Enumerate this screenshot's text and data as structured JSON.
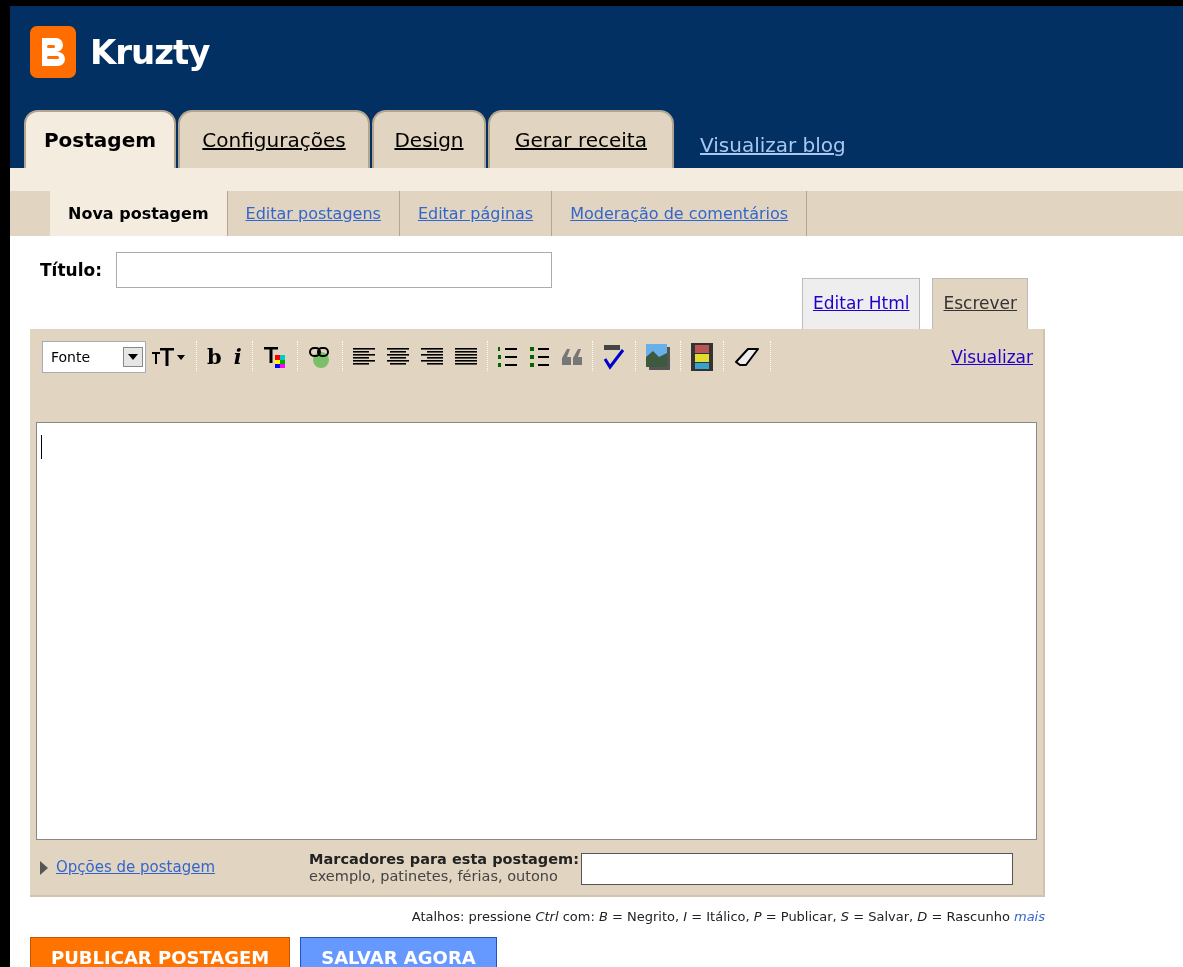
{
  "header": {
    "blog_title": "Kruzty",
    "view_blog_link": "Visualizar blog"
  },
  "tabs": [
    {
      "label": "Postagem",
      "selected": true
    },
    {
      "label": "Configurações",
      "selected": false
    },
    {
      "label": "Design",
      "selected": false
    },
    {
      "label": "Gerar receita",
      "selected": false
    }
  ],
  "subtabs": [
    {
      "label": "Nova postagem",
      "selected": true
    },
    {
      "label": "Editar postagens",
      "selected": false
    },
    {
      "label": "Editar páginas",
      "selected": false
    },
    {
      "label": "Moderação de comentários",
      "selected": false
    }
  ],
  "title_field": {
    "label": "Título:"
  },
  "editor_tabs": [
    {
      "label": "Editar Html",
      "selected": false
    },
    {
      "label": "Escrever",
      "selected": true
    }
  ],
  "toolbar": {
    "font_select": "Fonte",
    "bold_glyph": "b",
    "italic_glyph": "i",
    "preview_link": "Visualizar"
  },
  "post_options": {
    "label": "Opções de postagem",
    "expanded": false
  },
  "labels_field": {
    "label": "Marcadores para esta postagem:",
    "hint": "exemplo, patinetes, férias, outono"
  },
  "shortcuts": {
    "text": "Atalhos: pressione *Ctrl* com: *B* = Negrito, *I* = Itálico, *P* = Publicar, *S* = Salvar, *D* = Rascunho",
    "link": "mais"
  },
  "buttons": [
    {
      "label": "PUBLICAR POSTAGEM",
      "kind": "publish"
    },
    {
      "label": "SALVAR AGORA",
      "kind": "save"
    }
  ]
}
